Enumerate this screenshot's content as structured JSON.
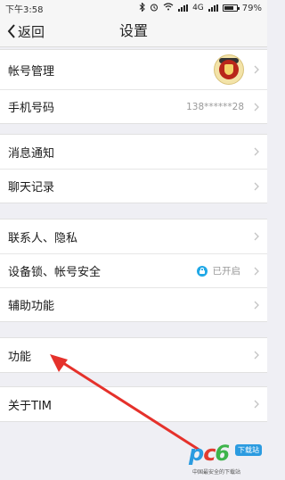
{
  "status_bar": {
    "time": "下午3:58",
    "network": "4G",
    "battery_percent": "79%",
    "battery_level": 0.79
  },
  "nav": {
    "back_label": "返回",
    "title": "设置"
  },
  "groups": [
    {
      "items": [
        {
          "label": "帐号管理",
          "type": "avatar"
        },
        {
          "label": "手机号码",
          "value": "138******28"
        }
      ]
    },
    {
      "items": [
        {
          "label": "消息通知"
        },
        {
          "label": "聊天记录"
        }
      ]
    },
    {
      "items": [
        {
          "label": "联系人、隐私"
        },
        {
          "label": "设备锁、帐号安全",
          "value": "已开启",
          "icon": "lock-icon"
        },
        {
          "label": "辅助功能"
        }
      ]
    },
    {
      "items": [
        {
          "label": "功能"
        }
      ]
    },
    {
      "items": [
        {
          "label": "关于TIM"
        }
      ]
    }
  ],
  "colors": {
    "arrow": "#e5312b",
    "lock_badge": "#20a8e6",
    "page_background": "#efeff4"
  },
  "watermark": {
    "logo": "pc6",
    "tag": "下载站",
    "subtitle": "中国最安全的下载站"
  }
}
